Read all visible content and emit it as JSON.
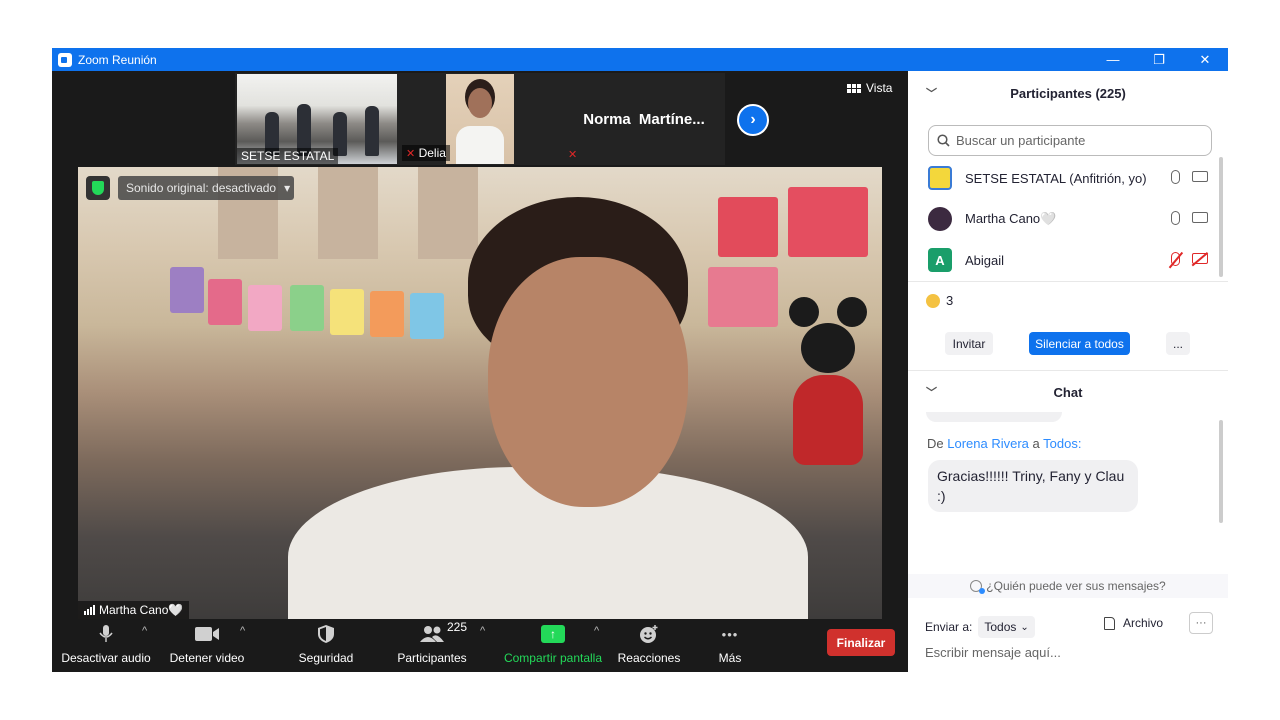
{
  "window": {
    "title": "Zoom Reunión",
    "minimize": "—",
    "restore": "❐",
    "close": "✕"
  },
  "gallery": {
    "thumbnails": [
      {
        "name": "SETSE ESTATAL"
      },
      {
        "name": "Delia"
      },
      {
        "name": "Norma  Martíne..."
      }
    ],
    "next_icon": "›",
    "view_label": "Vista"
  },
  "main_video": {
    "speaker": "Martha Cano🤍",
    "audio_status": "Sonido original: desactivado",
    "audio_caret": "▾"
  },
  "toolbar": {
    "items": [
      {
        "label": "Desactivar audio",
        "icon": "mic-icon"
      },
      {
        "label": "Detener video",
        "icon": "video-camera-icon"
      },
      {
        "label": "Seguridad",
        "icon": "shield-icon"
      },
      {
        "label": "Participantes",
        "icon": "participants-icon",
        "count": "225"
      },
      {
        "label": "Compartir pantalla",
        "icon": "share-screen-icon"
      },
      {
        "label": "Reacciones",
        "icon": "reactions-icon"
      },
      {
        "label": "Más",
        "icon": "more-dots-icon",
        "glyph": "•••"
      }
    ],
    "end_label": "Finalizar",
    "caret": "^"
  },
  "participants_panel": {
    "title": "Participantes (225)",
    "search_placeholder": "Buscar un participante",
    "participants": [
      {
        "name": "SETSE ESTATAL (Anfitrión, yo)",
        "mic": "on",
        "video": "on"
      },
      {
        "name": "Martha Cano🤍",
        "mic": "on",
        "video": "on"
      },
      {
        "name": "Abigail",
        "avatar_letter": "A",
        "mic": "muted",
        "video": "off"
      }
    ],
    "raised_hands_count": "3",
    "buttons": {
      "invite": "Invitar",
      "mute_all": "Silenciar a todos",
      "more": "..."
    }
  },
  "chat_panel": {
    "title": "Chat",
    "messages": [
      {
        "from_prefix": "De",
        "sender": "Lorena Rivera",
        "to_word": "a",
        "recipient": "Todos",
        "text": "Gracias!!!!!! Triny, Fany y Clau :)"
      }
    ],
    "who_can_see": "¿Quién puede ver sus mensajes?",
    "send_to_label": "Enviar a:",
    "send_to_value": "Todos",
    "file_label": "Archivo",
    "more": "···",
    "input_placeholder": "Escribir mensaje aquí..."
  },
  "colors": {
    "accent": "#0e72ed",
    "share_green": "#23d959",
    "end_red": "#d0312d",
    "muted_red": "#e02828",
    "abigail_avatar": "#1a9e6a"
  }
}
